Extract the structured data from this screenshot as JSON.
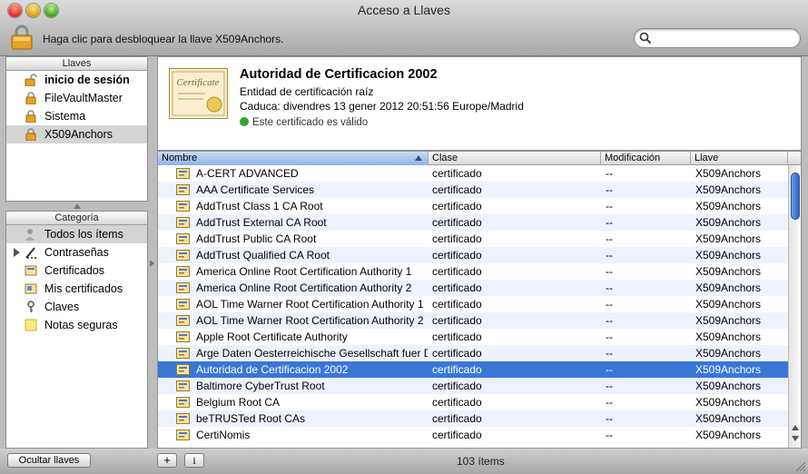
{
  "window": {
    "title": "Acceso a Llaves"
  },
  "toolbar": {
    "unlock_hint": "Haga clic para desbloquear la llave X509Anchors.",
    "search_placeholder": ""
  },
  "keychains": {
    "header": "Llaves",
    "items": [
      {
        "label": "inicio de sesión",
        "icon": "unlocked-lock-icon",
        "bold": true,
        "selected": false
      },
      {
        "label": "FileVaultMaster",
        "icon": "lock-icon",
        "bold": false,
        "selected": false
      },
      {
        "label": "Sistema",
        "icon": "lock-icon",
        "bold": false,
        "selected": false
      },
      {
        "label": "X509Anchors",
        "icon": "lock-icon",
        "bold": false,
        "selected": true
      }
    ]
  },
  "categories": {
    "header": "Categoría",
    "items": [
      {
        "label": "Todos los ítems",
        "icon": "people-icon",
        "selected": true
      },
      {
        "label": "Contraseñas",
        "icon": "pencil-icon",
        "selected": false,
        "expandable": true
      },
      {
        "label": "Certificados",
        "icon": "certificate-icon",
        "selected": false
      },
      {
        "label": "Mis certificados",
        "icon": "my-certificate-icon",
        "selected": false
      },
      {
        "label": "Claves",
        "icon": "key-icon",
        "selected": false
      },
      {
        "label": "Notas seguras",
        "icon": "note-icon",
        "selected": false
      }
    ]
  },
  "detail": {
    "title": "Autoridad de Certificacion 2002",
    "subtitle": "Entidad de certificación raíz",
    "expires": "Caduca: divendres 13 gener 2012 20:51:56 Europe/Madrid",
    "status": "Este certificado es válido",
    "cert_image_text": "Certificate"
  },
  "table": {
    "columns": [
      "Nombre",
      "Clase",
      "Modificación",
      "Llave"
    ],
    "sorted_column": 0,
    "selected_row": 12,
    "rows": [
      [
        "A-CERT ADVANCED",
        "certificado",
        "--",
        "X509Anchors"
      ],
      [
        "AAA Certificate Services",
        "certificado",
        "--",
        "X509Anchors"
      ],
      [
        "AddTrust Class 1 CA Root",
        "certificado",
        "--",
        "X509Anchors"
      ],
      [
        "AddTrust External CA Root",
        "certificado",
        "--",
        "X509Anchors"
      ],
      [
        "AddTrust Public CA Root",
        "certificado",
        "--",
        "X509Anchors"
      ],
      [
        "AddTrust Qualified CA Root",
        "certificado",
        "--",
        "X509Anchors"
      ],
      [
        "America Online Root Certification Authority 1",
        "certificado",
        "--",
        "X509Anchors"
      ],
      [
        "America Online Root Certification Authority 2",
        "certificado",
        "--",
        "X509Anchors"
      ],
      [
        "AOL Time Warner Root Certification Authority 1",
        "certificado",
        "--",
        "X509Anchors"
      ],
      [
        "AOL Time Warner Root Certification Authority 2",
        "certificado",
        "--",
        "X509Anchors"
      ],
      [
        "Apple Root Certificate Authority",
        "certificado",
        "--",
        "X509Anchors"
      ],
      [
        "Arge Daten Oesterreichische Gesellschaft fuer D",
        "certificado",
        "--",
        "X509Anchors"
      ],
      [
        "Autoridad de Certificacion 2002",
        "certificado",
        "--",
        "X509Anchors"
      ],
      [
        "Baltimore CyberTrust Root",
        "certificado",
        "--",
        "X509Anchors"
      ],
      [
        "Belgium Root CA",
        "certificado",
        "--",
        "X509Anchors"
      ],
      [
        "beTRUSTed Root CAs",
        "certificado",
        "--",
        "X509Anchors"
      ],
      [
        "CertiNomis",
        "certificado",
        "--",
        "X509Anchors"
      ]
    ]
  },
  "footer": {
    "hide_label": "Ocultar llaves",
    "add_label": "+",
    "info_label": "i",
    "count": "103 ítems"
  },
  "colors": {
    "selection": "#3877d6",
    "stripe": "#edf3fe",
    "valid": "#31a82e"
  }
}
